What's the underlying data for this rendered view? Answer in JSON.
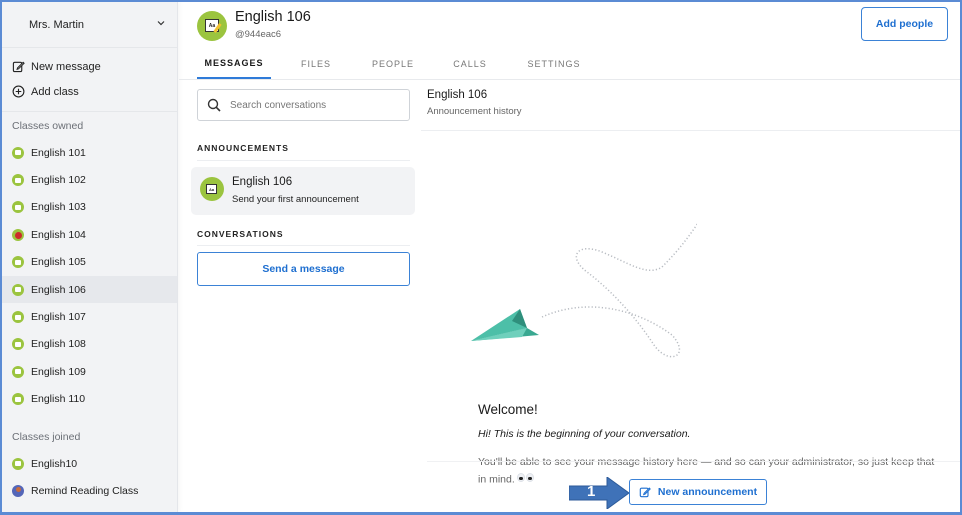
{
  "sidebar": {
    "account_name": "Mrs. Martin",
    "actions": [
      {
        "label": "New message",
        "icon": "edit-icon"
      },
      {
        "label": "Add class",
        "icon": "plus-circle-icon"
      }
    ],
    "owned_label": "Classes owned",
    "owned_classes": [
      {
        "label": "English 101",
        "icon": "book-icon"
      },
      {
        "label": "English 102",
        "icon": "book-icon"
      },
      {
        "label": "English 103",
        "icon": "book-icon"
      },
      {
        "label": "English 104",
        "icon": "apple-icon"
      },
      {
        "label": "English 105",
        "icon": "book-icon"
      },
      {
        "label": "English 106",
        "icon": "book-icon",
        "active": true
      },
      {
        "label": "English 107",
        "icon": "book-icon"
      },
      {
        "label": "English 108",
        "icon": "book-icon"
      },
      {
        "label": "English 109",
        "icon": "book-icon"
      },
      {
        "label": "English 110",
        "icon": "book-icon"
      }
    ],
    "joined_label": "Classes joined",
    "joined_classes": [
      {
        "label": "English10",
        "icon": "book-icon"
      },
      {
        "label": "Remind Reading Class",
        "icon": "person-icon"
      }
    ]
  },
  "header": {
    "class_title": "English 106",
    "class_code": "@944eac6",
    "avatar_text": "Aa",
    "add_people_label": "Add people",
    "tabs": [
      {
        "label": "MESSAGES",
        "active": true
      },
      {
        "label": "FILES"
      },
      {
        "label": "PEOPLE"
      },
      {
        "label": "CALLS"
      },
      {
        "label": "SETTINGS"
      }
    ]
  },
  "conversations": {
    "search_placeholder": "Search conversations",
    "announcements_heading": "ANNOUNCEMENTS",
    "announcement_item": {
      "name": "English 106",
      "subtitle": "Send your first announcement",
      "avatar_text": "Aa"
    },
    "conversations_heading": "CONVERSATIONS",
    "send_message_label": "Send a message"
  },
  "main": {
    "title": "English 106",
    "subtitle": "Announcement history",
    "welcome": "Welcome!",
    "intro": "Hi! This is the beginning of your conversation.",
    "body": "You'll be able to see your message history here — and so can your administrator, so just keep that in mind.",
    "new_announcement_label": "New announcement"
  },
  "annotation": {
    "step_number": "1",
    "color": "#3f72b8"
  },
  "colors": {
    "accent": "#1e6fd0",
    "class_green": "#9bc43f",
    "plane_teal": "#4dbfa8",
    "frame_border": "#5b8bd4"
  }
}
